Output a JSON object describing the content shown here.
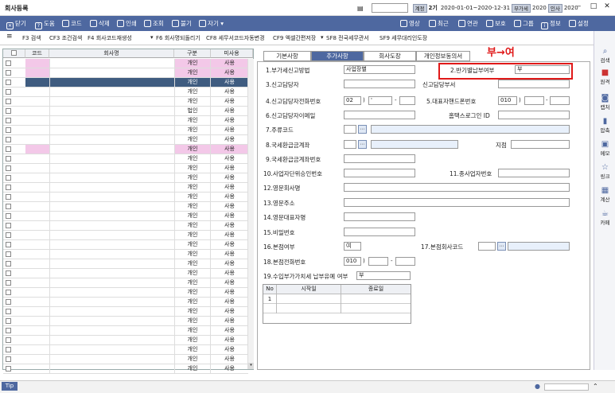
{
  "window": {
    "title": "회사등록",
    "tag_gyeolsan": "계정",
    "period_no": "2기",
    "period_range": "2020-01-01~2020-12-31",
    "tag_bugase": "부가세",
    "bugase_year": "2020",
    "tag_insa": "인사",
    "insa_year": "2020"
  },
  "toolbar": {
    "close": "닫기",
    "help": "도움",
    "code": "코드",
    "delete": "삭제",
    "print": "인쇄",
    "search": "조회",
    "import": "불기",
    "more": "자기",
    "video": "영상",
    "recent": "최근",
    "connect": "연관",
    "protect": "보호",
    "group": "그룹",
    "info": "정보",
    "settings": "설정"
  },
  "menubar": {
    "f3": "F3 검색",
    "cf3": "CF3 조건검색",
    "f4": "F4 회사코드재생성",
    "f6": "F6 회사명되돌리기",
    "cf8": "CF8 세무서코드자동변경",
    "cf9": "CF9 엑셀간편저장",
    "sf8": "SF8 전국세무관서",
    "sf9": "SF9 세무대리인도장"
  },
  "grid": {
    "headers": [
      "코드",
      "회사명",
      "구분",
      "미사용"
    ],
    "rows": [
      {
        "type": "개인",
        "use": "사용"
      },
      {
        "type": "개인",
        "use": "사용"
      },
      {
        "type": "개인",
        "use": "사용"
      },
      {
        "type": "개인",
        "use": "사용"
      },
      {
        "type": "개인",
        "use": "사용"
      },
      {
        "type": "법인",
        "use": "사용"
      },
      {
        "type": "개인",
        "use": "사용"
      },
      {
        "type": "개인",
        "use": "사용"
      },
      {
        "type": "개인",
        "use": "사용"
      },
      {
        "type": "개인",
        "use": "사용"
      },
      {
        "type": "개인",
        "use": "사용"
      },
      {
        "type": "개인",
        "use": "사용"
      },
      {
        "type": "개인",
        "use": "사용"
      },
      {
        "type": "개인",
        "use": "사용"
      },
      {
        "type": "개인",
        "use": "사용"
      },
      {
        "type": "개인",
        "use": "사용"
      },
      {
        "type": "개인",
        "use": "사용"
      },
      {
        "type": "개인",
        "use": "사용"
      },
      {
        "type": "개인",
        "use": "사용"
      },
      {
        "type": "개인",
        "use": "사용"
      },
      {
        "type": "개인",
        "use": "사용"
      },
      {
        "type": "개인",
        "use": "사용"
      },
      {
        "type": "개인",
        "use": "사용"
      },
      {
        "type": "개인",
        "use": "사용"
      },
      {
        "type": "개인",
        "use": "사용"
      },
      {
        "type": "개인",
        "use": "사용"
      },
      {
        "type": "개인",
        "use": "사용"
      },
      {
        "type": "개인",
        "use": "사용"
      },
      {
        "type": "개인",
        "use": "사용"
      },
      {
        "type": "개인",
        "use": "사용"
      },
      {
        "type": "개인",
        "use": "사용"
      },
      {
        "type": "개인",
        "use": "사용"
      },
      {
        "type": "개인",
        "use": "사용"
      }
    ]
  },
  "tabs": [
    "기본사항",
    "추가사항",
    "회사도장",
    "개인정보동의서"
  ],
  "form": {
    "l1": "1.부가세신고방법",
    "v1": "사업장별",
    "l2": "2.반기별납부여부",
    "v2": "부",
    "l3": "3.신고담당자",
    "l3b": "신고담당부서",
    "l4": "4.신고담당자전화번호",
    "v4a": "02",
    "v4b": "'",
    "l5": "5.대표자핸드폰번호",
    "v5a": "010",
    "l6": "6.신고담당자이메일",
    "l6b": "홈택스로그인 ID",
    "l7": "7.주류코드",
    "l8": "8.국세환급금계좌",
    "l8b": "지점",
    "l9": "9.국세환급금계좌번호",
    "l10": "10.사업자단위승인번호",
    "l11": "11.종사업자번호",
    "l12": "12.영문회사명",
    "l13": "13.영문주소",
    "l14": "14.영문대표자명",
    "l15": "15.비밀번호",
    "l16": "16.본점여부",
    "v16": "여",
    "l17": "17.본점회사코드",
    "l18": "18.본점전화번호",
    "v18": "010",
    "l19": "19.수입부가가치세 납부유예 여부",
    "v19": "부",
    "paren": ")",
    "dash": "-"
  },
  "mini_table": {
    "headers": [
      "No",
      "시작일",
      "종료일"
    ],
    "row_no": "1"
  },
  "annotation": {
    "text": "부→여",
    "color": "#e01919"
  },
  "sidebar": [
    "검색",
    "원격",
    "캡처",
    "압축",
    "메모",
    "링크",
    "계산",
    "카페"
  ],
  "status": {
    "tip": "Tip"
  },
  "colors": {
    "toolbar": "#4e68a0",
    "selected_row": "#3f5c80",
    "pink_row": "#f3c8e8",
    "annotation": "#e01919"
  }
}
